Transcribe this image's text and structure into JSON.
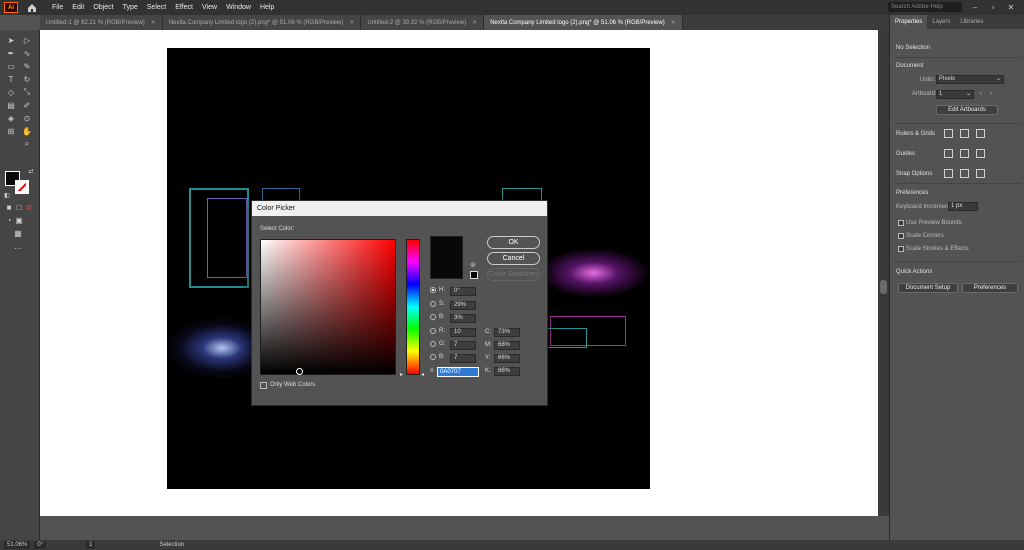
{
  "app": {
    "logo": "Ai"
  },
  "menubar": {
    "items": [
      "File",
      "Edit",
      "Object",
      "Type",
      "Select",
      "Effect",
      "View",
      "Window",
      "Help"
    ],
    "search_placeholder": "Search Adobe Help"
  },
  "tabs": [
    {
      "label": "Untitled-1 @ 82.21 % (RGB/Preview)",
      "active": false
    },
    {
      "label": "Nexlta Company Limited logo (2).png* @ 51.06 % (RGB/Preview)",
      "active": false
    },
    {
      "label": "Untitled-2 @ 39.32 % (RGB/Preview)",
      "active": false
    },
    {
      "label": "Nexlta Company Limited logo (2).png* @ 51.06 % (RGB/Preview)",
      "active": true
    }
  ],
  "colors": {
    "fill": "#0A0707",
    "accent_blue": "#2d7bd6"
  },
  "dialog": {
    "title": "Color Picker",
    "select_color_label": "Select Color:",
    "ok_label": "OK",
    "cancel_label": "Cancel",
    "swatches_label": "Color Swatches",
    "only_web_colors_label": "Only Web Colors",
    "fields": {
      "H": {
        "label": "H:",
        "value": "0°"
      },
      "S": {
        "label": "S:",
        "value": "29%"
      },
      "B": {
        "label": "B:",
        "value": "3%"
      },
      "R": {
        "label": "R:",
        "value": "10"
      },
      "G": {
        "label": "G:",
        "value": "7"
      },
      "Bl": {
        "label": "B:",
        "value": "7"
      },
      "C": {
        "label": "C:",
        "value": "73%"
      },
      "M": {
        "label": "M:",
        "value": "68%"
      },
      "Y": {
        "label": "Y:",
        "value": "66%"
      },
      "K": {
        "label": "K:",
        "value": "86%"
      },
      "hash": "#",
      "hex": "0A0707"
    }
  },
  "panel": {
    "tabs": [
      "Properties",
      "Layers",
      "Libraries"
    ],
    "no_selection": "No Selection",
    "document_header": "Document",
    "units_label": "Units:",
    "units_value": "Pixels",
    "artboard_label": "Artboard:",
    "artboard_value": "1",
    "edit_artboards_label": "Edit Artboards",
    "rulers_grids_label": "Rulers & Grids",
    "guides_label": "Guides",
    "snap_options_label": "Snap Options",
    "preferences_header": "Preferences",
    "keyboard_increment_label": "Keyboard Increment:",
    "keyboard_increment_value": "1 px",
    "use_preview_bounds": "Use Preview Bounds",
    "scale_corners": "Scale Corners",
    "scale_strokes": "Scale Strokes & Effects",
    "quick_actions_header": "Quick Actions",
    "document_setup_label": "Document Setup",
    "preferences_label": "Preferences"
  },
  "statusbar": {
    "zoom": "51.06%",
    "rotation": "0°",
    "artboard": "1",
    "tool": "Selection"
  }
}
